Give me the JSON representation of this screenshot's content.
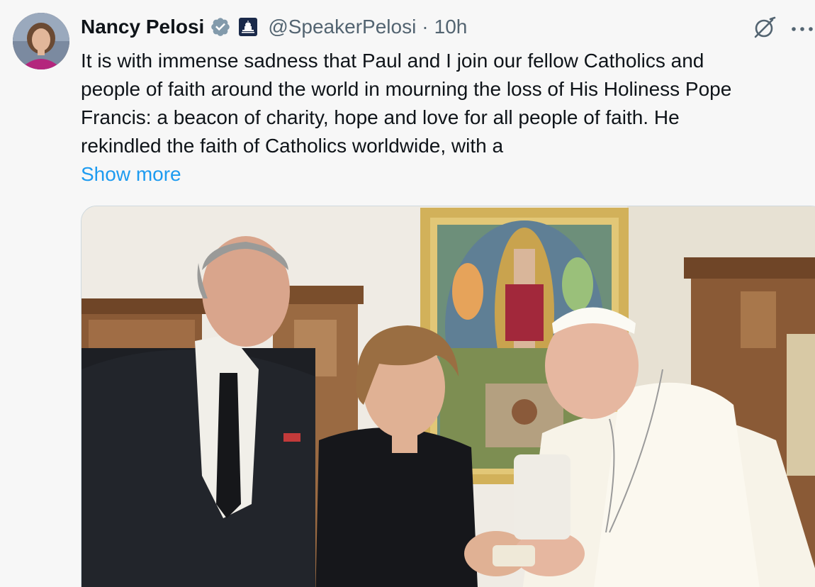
{
  "author": {
    "name": "Nancy Pelosi",
    "handle": "@SpeakerPelosi",
    "separator": "·",
    "time": "10h",
    "verified_icon": "verified-badge-icon",
    "affiliation_icon": "capitol-affiliation-icon"
  },
  "tweet": {
    "lines": [
      "It is with immense sadness that Paul and I join our fellow Catholics and",
      "people of faith around the world in mourning the loss of His Holiness Pope",
      "Francis: a beacon of charity, hope and love for all people of faith. He",
      "rekindled the faith of Catholics worldwide, with a"
    ],
    "show_more": "Show more"
  },
  "actions": {
    "grok_icon": "grok-icon",
    "more_icon": "more-options-icon"
  },
  "colors": {
    "link": "#1d9bf0",
    "secondary_text": "#536471",
    "primary_text": "#0f1419",
    "verified": "#829aab",
    "background": "#f7f7f7"
  },
  "media": {
    "type": "photo",
    "subject": "photo-pelosis-with-pope"
  }
}
